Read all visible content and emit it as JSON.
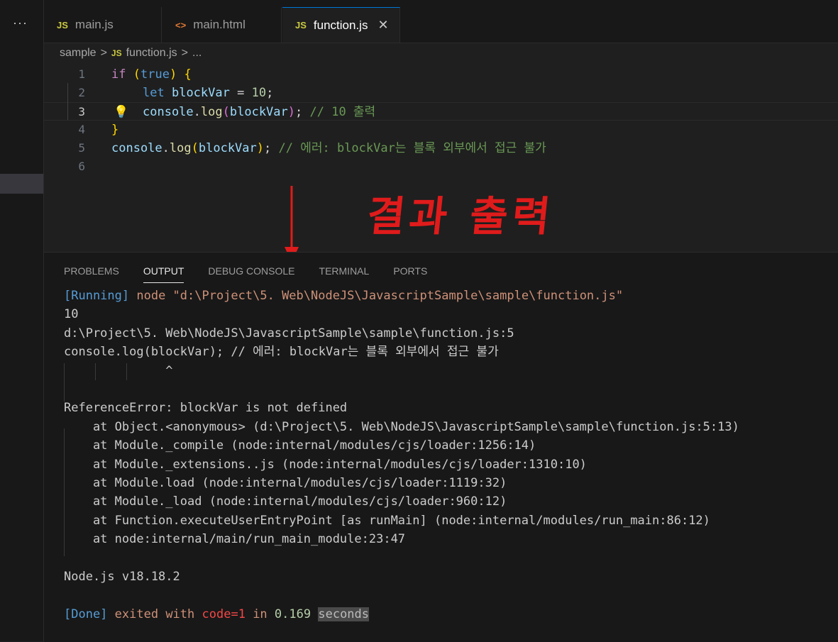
{
  "sidebar": {
    "more_label": "···"
  },
  "tabs": [
    {
      "icon": "JS",
      "label": "main.js"
    },
    {
      "icon": "<>",
      "label": "main.html"
    },
    {
      "icon": "JS",
      "label": "function.js",
      "close": "✕"
    }
  ],
  "breadcrumb": {
    "folder": "sample",
    "sep": ">",
    "file_icon": "JS",
    "file": "function.js",
    "more": "..."
  },
  "editor": {
    "line_numbers": [
      "1",
      "2",
      "3",
      "4",
      "5",
      "6"
    ],
    "line2_var": "blockVar",
    "line3_comment": "// 10 출력",
    "line5_comment": "// 에러: blockVar는 블록 외부에서 접근 불가"
  },
  "annotation": {
    "text": "결과 출력"
  },
  "panel": {
    "tabs": [
      "PROBLEMS",
      "OUTPUT",
      "DEBUG CONSOLE",
      "TERMINAL",
      "PORTS"
    ],
    "output": {
      "running_tag": "[Running]",
      "running_cmd": "node \"d:\\Project\\5. Web\\NodeJS\\JavascriptSample\\sample\\function.js\"",
      "lines": [
        "10",
        "d:\\Project\\5. Web\\NodeJS\\JavascriptSample\\sample\\function.js:5",
        "console.log(blockVar); // 에러: blockVar는 블록 외부에서 접근 불가",
        "              ^",
        "",
        "ReferenceError: blockVar is not defined",
        "    at Object.<anonymous> (d:\\Project\\5. Web\\NodeJS\\JavascriptSample\\sample\\function.js:5:13)",
        "    at Module._compile (node:internal/modules/cjs/loader:1256:14)",
        "    at Module._extensions..js (node:internal/modules/cjs/loader:1310:10)",
        "    at Module.load (node:internal/modules/cjs/loader:1119:32)",
        "    at Module._load (node:internal/modules/cjs/loader:960:12)",
        "    at Function.executeUserEntryPoint [as runMain] (node:internal/modules/run_main:86:12)",
        "    at node:internal/main/run_main_module:23:47",
        "",
        "Node.js v18.18.2",
        ""
      ],
      "done_tag": "[Done]",
      "done_exited": "exited with",
      "done_code": "code=1",
      "done_in": "in",
      "done_time": "0.169",
      "done_seconds": "seconds"
    }
  },
  "colors": {
    "accent": "#0078d4",
    "annotation": "#e01b1b",
    "background": "#1f1f1f"
  }
}
